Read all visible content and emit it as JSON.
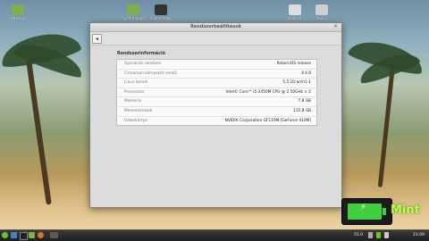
{
  "desktop": {
    "icons": [
      {
        "label": "Petra (g)",
        "icon": "folder-icon",
        "color": "#7fae4a"
      },
      {
        "label": "Saját mappa",
        "icon": "home-folder-icon",
        "color": "#7fae4a"
      },
      {
        "label": "Számítógép",
        "icon": "monitor-icon",
        "color": "#333333"
      },
      {
        "label": "Hálózat",
        "icon": "network-icon",
        "color": "#dddddd"
      },
      {
        "label": "Kuka",
        "icon": "trash-icon",
        "color": "#cfcfcf"
      }
    ]
  },
  "window": {
    "title": "Rendszerbeállítások",
    "close_glyph": "×",
    "back_glyph": "◂",
    "section_title": "Rendszerinformáció",
    "rows": [
      {
        "key": "Operációs rendszer",
        "value": "RebornOS release"
      },
      {
        "key": "Cinnamon környezet verzió",
        "value": "4.4.8"
      },
      {
        "key": "Linux kernel",
        "value": "5.5.10-arch1-1"
      },
      {
        "key": "Processzor",
        "value": "Intel© Core™ i5-2450M CPU @ 2.50GHz × 2"
      },
      {
        "key": "Memória",
        "value": "7.8 GB"
      },
      {
        "key": "Merevlemezek",
        "value": "115.8 GB"
      },
      {
        "key": "Videokártya",
        "value": "NVIDIA Corporation GF119M [GeForce 410M]"
      }
    ]
  },
  "battery": {
    "logo": "Mint"
  },
  "panel": {
    "tray_volume": "55.0",
    "clock": "21:09",
    "accent": "#6fbf2f"
  }
}
